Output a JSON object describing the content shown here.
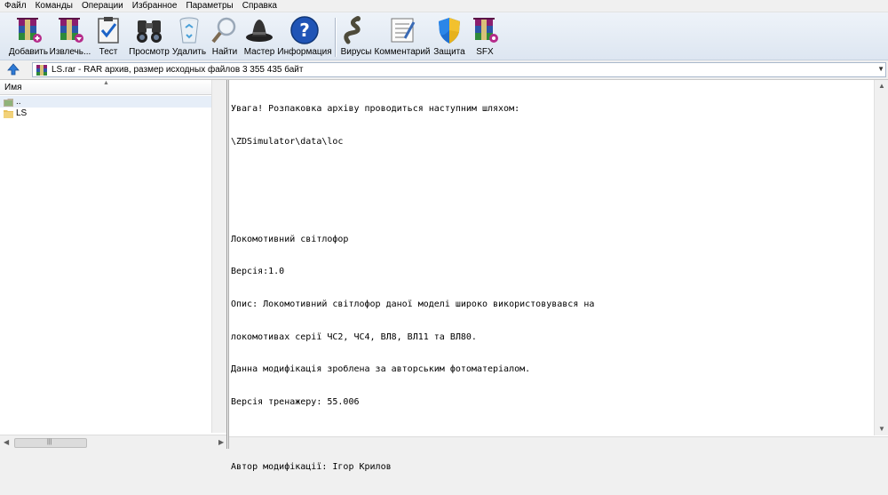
{
  "menu": {
    "items": [
      "Файл",
      "Команды",
      "Операции",
      "Избранное",
      "Параметры",
      "Справка"
    ]
  },
  "toolbar": {
    "buttons": [
      {
        "label": "Добавить",
        "icon": "add-archive-icon"
      },
      {
        "label": "Извлечь...",
        "icon": "extract-archive-icon"
      },
      {
        "label": "Тест",
        "icon": "test-clipboard-icon"
      },
      {
        "label": "Просмотр",
        "icon": "binoculars-icon"
      },
      {
        "label": "Удалить",
        "icon": "recycle-bin-icon"
      },
      {
        "label": "Найти",
        "icon": "magnifier-icon"
      },
      {
        "label": "Мастер",
        "icon": "wizard-hat-icon"
      },
      {
        "label": "Информация",
        "icon": "info-icon"
      },
      {
        "label": "Вирусы",
        "icon": "virus-snake-icon"
      },
      {
        "label": "Комментарий",
        "icon": "comment-icon"
      },
      {
        "label": "Защита",
        "icon": "shield-icon"
      },
      {
        "label": "SFX",
        "icon": "sfx-archive-icon"
      }
    ]
  },
  "address": {
    "text": "LS.rar - RAR архив, размер исходных файлов 3 355 435 байт"
  },
  "file_pane": {
    "column_header": "Имя",
    "rows": [
      {
        "name": ".."
      },
      {
        "name": "LS"
      }
    ]
  },
  "comment_pane": {
    "lines": [
      "Увага! Розпаковка архіву проводиться наступним шляхом:",
      "\\ZDSimulator\\data\\loc",
      "",
      "",
      "Локомотивний світлофор",
      "Версія:1.0",
      "Опис: Локомотивний світлофор даної моделі широко використовувався на",
      "локомотивах серії ЧС2, ЧС4, ВЛ8, ВЛ11 та ВЛ80.",
      "Данна модифікація зроблена за авторським фотоматеріалом.",
      "Версія тренажеру: 55.006",
      "",
      "Автор модифікації: Ігор Крилов"
    ]
  },
  "colors": {
    "toolbar_bg": "#dde6f1",
    "selection": "#e6eef8",
    "folder": "#e8c15a"
  }
}
